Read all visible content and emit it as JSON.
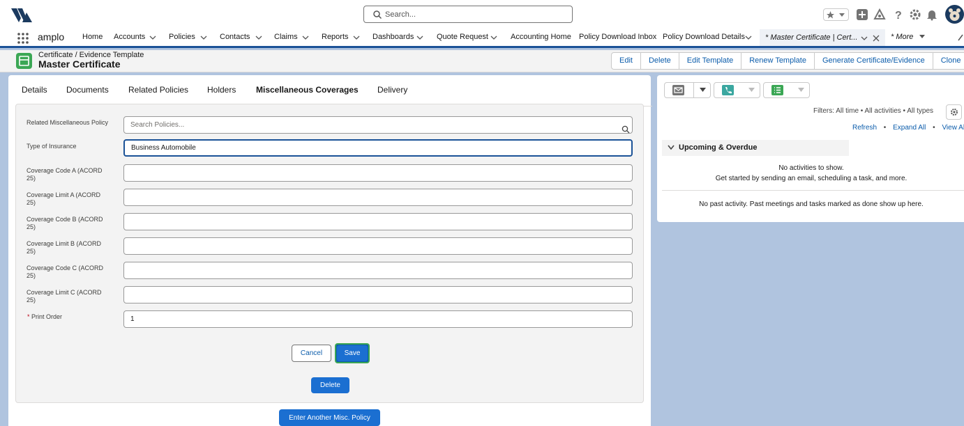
{
  "search": {
    "placeholder": "Search..."
  },
  "nav": {
    "app_name": "amplo",
    "items": [
      {
        "label": "Home"
      },
      {
        "label": "Accounts"
      },
      {
        "label": "Policies"
      },
      {
        "label": "Contacts"
      },
      {
        "label": "Claims"
      },
      {
        "label": "Reports"
      },
      {
        "label": "Dashboards"
      },
      {
        "label": "Quote Request"
      },
      {
        "label": "Accounting Home"
      },
      {
        "label": "Policy Download Inbox"
      },
      {
        "label": "Policy Download Details"
      }
    ],
    "active_tab": "* Master Certificate | Cert...",
    "more_label": "* More"
  },
  "record": {
    "object_type": "Certificate / Evidence Template",
    "title": "Master Certificate",
    "actions": [
      "Edit",
      "Delete",
      "Edit Template",
      "Renew Template",
      "Generate Certificate/Evidence",
      "Clone"
    ]
  },
  "tabs": [
    "Details",
    "Documents",
    "Related Policies",
    "Holders",
    "Miscellaneous Coverages",
    "Delivery"
  ],
  "active_tab_index": 4,
  "form": {
    "related_policy": {
      "label": "Related Miscellaneous Policy",
      "placeholder": "Search Policies...",
      "value": ""
    },
    "type_of_insurance": {
      "label": "Type of Insurance",
      "value": "Business Automobile"
    },
    "coverage_code_a": {
      "label": "Coverage Code A (ACORD 25)",
      "value": ""
    },
    "coverage_limit_a": {
      "label": "Coverage Limit A (ACORD 25)",
      "value": ""
    },
    "coverage_code_b": {
      "label": "Coverage Code B (ACORD 25)",
      "value": ""
    },
    "coverage_limit_b": {
      "label": "Coverage Limit B (ACORD 25)",
      "value": ""
    },
    "coverage_code_c": {
      "label": "Coverage Code C (ACORD 25)",
      "value": ""
    },
    "coverage_limit_c": {
      "label": "Coverage Limit C (ACORD 25)",
      "value": ""
    },
    "print_order": {
      "label": "Print Order",
      "required_mark": "*",
      "value": "1"
    },
    "cancel_label": "Cancel",
    "save_label": "Save",
    "delete_label": "Delete",
    "another_label": "Enter Another Misc. Policy"
  },
  "activity": {
    "filters": "Filters: All time • All activities • All types",
    "refresh": "Refresh",
    "expand_all": "Expand All",
    "view_all": "View All",
    "sep": "•",
    "upcoming_title": "Upcoming & Overdue",
    "no_activities": "No activities to show.",
    "get_started": "Get started by sending an email, scheduling a task, and more.",
    "no_past": "No past activity. Past meetings and tasks marked as done show up here."
  },
  "colors": {
    "brand": "#1b5297",
    "link": "#0b5cab",
    "button": "#1b6fd1",
    "object_icon": "#3ba755"
  }
}
